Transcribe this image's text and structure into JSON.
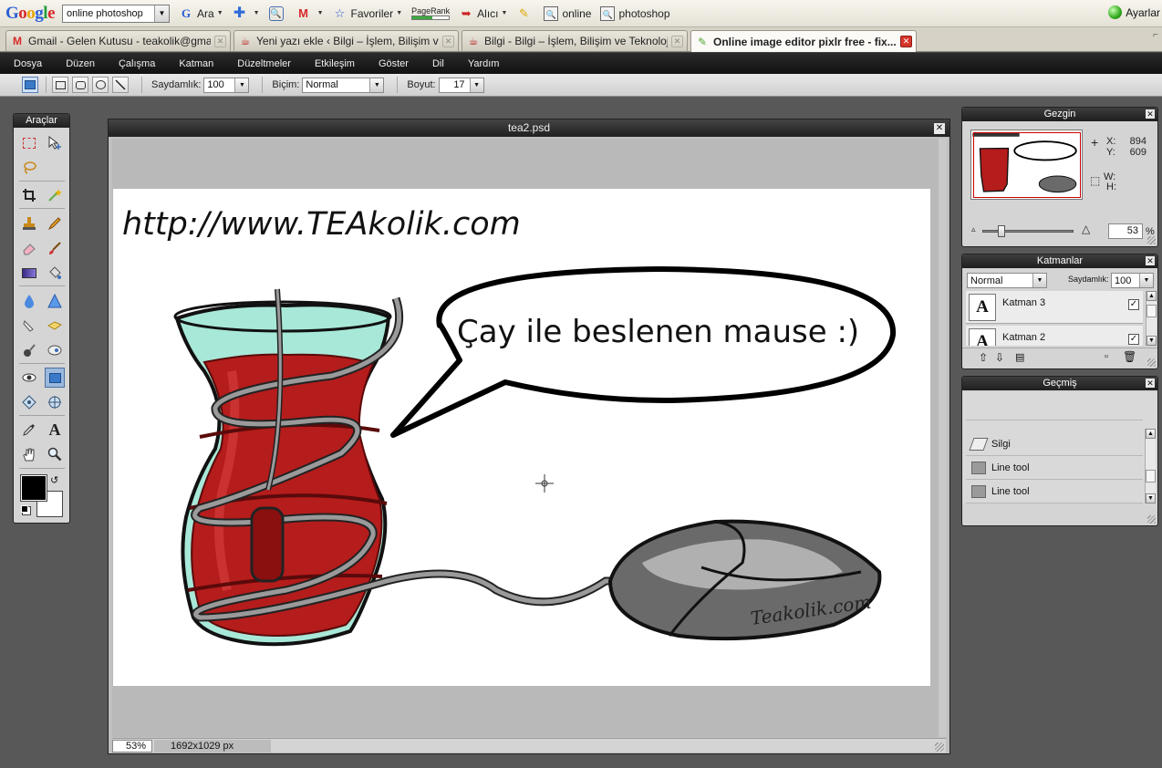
{
  "google_toolbar": {
    "logo": "Google",
    "search_value": "online photoshop",
    "buttons": [
      {
        "label": "Ara",
        "icon": "google-g-icon"
      },
      {
        "label": "",
        "icon": "plus-icon"
      },
      {
        "label": "",
        "icon": "magnifier-person-icon"
      },
      {
        "label": "",
        "icon": "gmail-icon"
      },
      {
        "label": "Favoriler",
        "icon": "star-icon"
      },
      {
        "label": "PageRank",
        "icon": "pagerank-bar-icon"
      },
      {
        "label": "Alıcı",
        "icon": "sendto-icon"
      },
      {
        "label": "",
        "icon": "highlighter-icon"
      },
      {
        "label": "online",
        "icon": "search-term-icon"
      },
      {
        "label": "photoshop",
        "icon": "search-term-icon"
      }
    ],
    "settings_label": "Ayarlar"
  },
  "tabs": [
    {
      "label": "Gmail - Gelen Kutusu - teakolik@gmail....",
      "icon": "gmail-icon"
    },
    {
      "label": "Yeni yazı ekle ‹ Bilgi – İşlem, Bilişim ve ...",
      "icon": "tea-icon"
    },
    {
      "label": "Bilgi - Bilgi – İşlem, Bilişim ve Teknoloji ...",
      "icon": "tea-icon"
    },
    {
      "label": "Online image editor pixlr free - fix...",
      "icon": "brush-icon",
      "active": true
    }
  ],
  "menu": [
    "Dosya",
    "Düzen",
    "Çalışma",
    "Katman",
    "Düzeltmeler",
    "Etkileşim",
    "Göster",
    "Dil",
    "Yardım"
  ],
  "options": {
    "opacity_label": "Saydamlık:",
    "opacity_value": "100",
    "mode_label": "Biçim:",
    "mode_value": "Normal",
    "size_label": "Boyut:",
    "size_value": "17"
  },
  "tools_panel": {
    "title": "Araçlar",
    "foreground_color": "#000000",
    "background_color": "#ffffff"
  },
  "document": {
    "title": "tea2.psd",
    "zoom": "53%",
    "dimensions": "1692x1029 px",
    "image_url_text": "http://www.TEAkolik.com",
    "speech_text": "Çay ile beslenen mause :)",
    "signature": "Teakolik.com"
  },
  "navigator": {
    "title": "Gezgin",
    "x_label": "X:",
    "x_value": "894",
    "y_label": "Y:",
    "y_value": "609",
    "w_label": "W:",
    "h_label": "H:",
    "zoom_value": "53",
    "zoom_unit": "%"
  },
  "layers": {
    "title": "Katmanlar",
    "mode": "Normal",
    "opacity_label": "Saydamlık:",
    "opacity_value": "100",
    "items": [
      {
        "name": "Katman 3",
        "thumb": "A"
      },
      {
        "name": "Katman 2",
        "thumb": "A"
      }
    ]
  },
  "history": {
    "title": "Geçmiş",
    "items": [
      {
        "label": "Silgi",
        "icon": "eraser-icon"
      },
      {
        "label": "Line tool",
        "icon": "line-tool-icon"
      },
      {
        "label": "Line tool",
        "icon": "line-tool-icon"
      }
    ]
  }
}
